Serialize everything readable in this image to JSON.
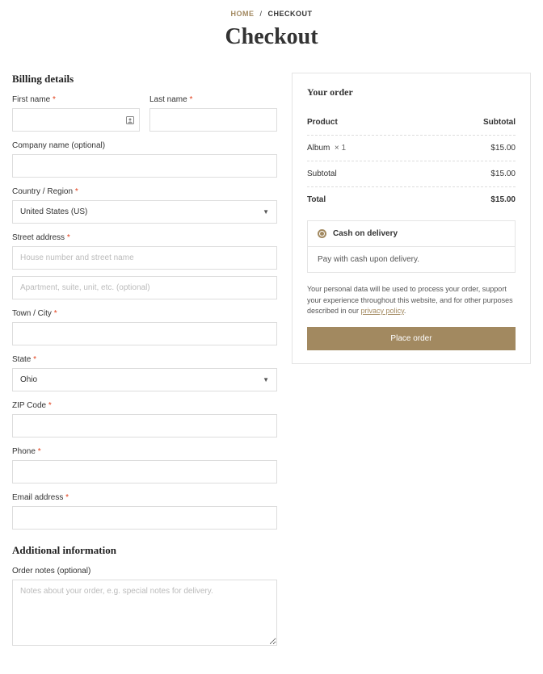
{
  "breadcrumb": {
    "home": "HOME",
    "current": "CHECKOUT"
  },
  "page_title": "Checkout",
  "billing": {
    "heading": "Billing details",
    "first_name": {
      "label": "First name"
    },
    "last_name": {
      "label": "Last name"
    },
    "company": {
      "label": "Company name (optional)"
    },
    "country": {
      "label": "Country / Region",
      "value": "United States (US)"
    },
    "street": {
      "label": "Street address",
      "ph1": "House number and street name",
      "ph2": "Apartment, suite, unit, etc. (optional)"
    },
    "city": {
      "label": "Town / City"
    },
    "state": {
      "label": "State",
      "value": "Ohio"
    },
    "zip": {
      "label": "ZIP Code"
    },
    "phone": {
      "label": "Phone"
    },
    "email": {
      "label": "Email address"
    }
  },
  "additional": {
    "heading": "Additional information",
    "notes": {
      "label": "Order notes (optional)",
      "ph": "Notes about your order, e.g. special notes for delivery."
    }
  },
  "order": {
    "heading": "Your order",
    "col_product": "Product",
    "col_subtotal": "Subtotal",
    "item_name": "Album",
    "item_qty": "× 1",
    "item_price": "$15.00",
    "subtotal_label": "Subtotal",
    "subtotal_value": "$15.00",
    "total_label": "Total",
    "total_value": "$15.00"
  },
  "payment": {
    "method": "Cash on delivery",
    "desc": "Pay with cash upon delivery."
  },
  "privacy": {
    "text": "Your personal data will be used to process your order, support your experience throughout this website, and for other purposes described in our ",
    "link": "privacy policy"
  },
  "place_order": "Place order"
}
